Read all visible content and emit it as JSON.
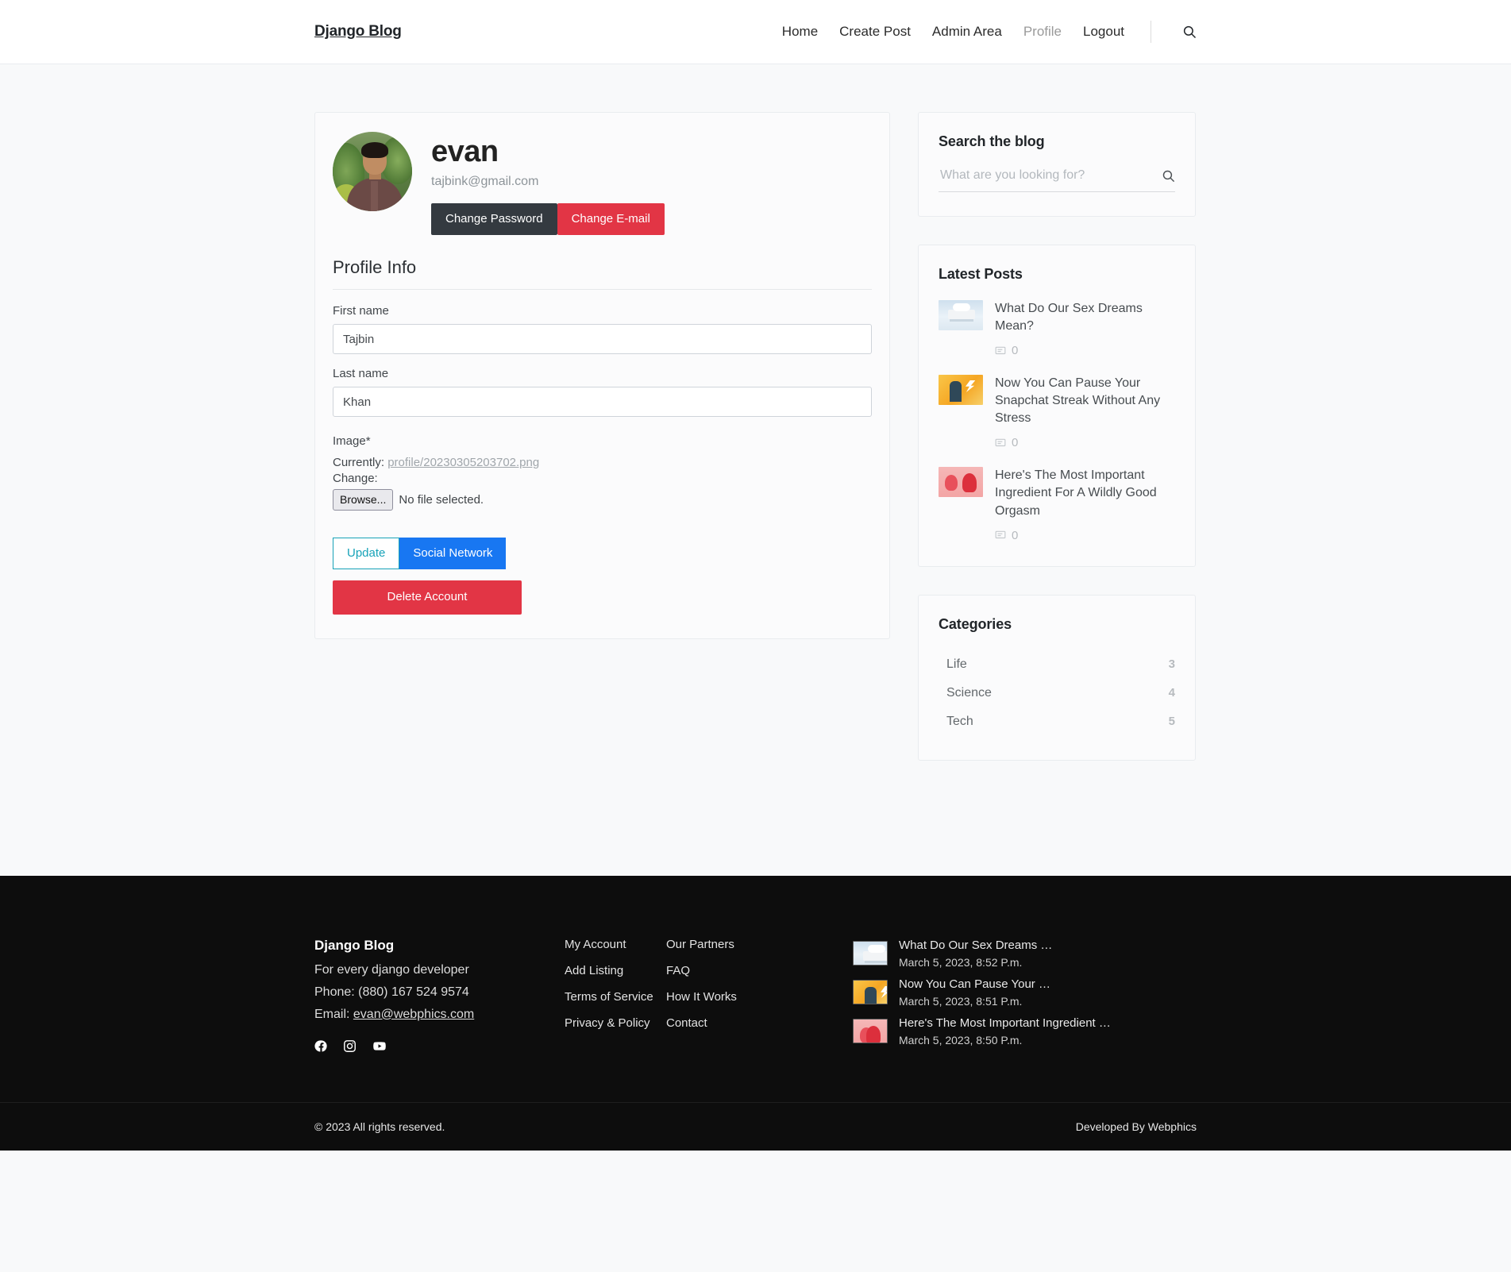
{
  "header": {
    "brand": "Django Blog",
    "nav": [
      {
        "label": "Home",
        "active": false
      },
      {
        "label": "Create Post",
        "active": false
      },
      {
        "label": "Admin Area",
        "active": false
      },
      {
        "label": "Profile",
        "active": true
      },
      {
        "label": "Logout",
        "active": false
      }
    ],
    "search_icon": "search-icon"
  },
  "profile": {
    "username": "evan",
    "email": "tajbink@gmail.com",
    "change_password_label": "Change Password",
    "change_email_label": "Change E-mail",
    "section_title": "Profile Info",
    "first_name_label": "First name",
    "first_name_value": "Tajbin",
    "last_name_label": "Last name",
    "last_name_value": "Khan",
    "image_label": "Image*",
    "currently_label": "Currently:",
    "currently_value": "profile/20230305203702.png",
    "change_label": "Change:",
    "browse_label": "Browse...",
    "file_status": "No file selected.",
    "update_label": "Update",
    "social_network_label": "Social Network",
    "delete_account_label": "Delete Account"
  },
  "sidebar": {
    "search": {
      "title": "Search the blog",
      "placeholder": "What are you looking for?",
      "value": ""
    },
    "latest_posts": {
      "title": "Latest Posts",
      "items": [
        {
          "title": "What Do Our Sex Dreams Mean?",
          "comments": "0",
          "thumb": "t-bed"
        },
        {
          "title": "Now You Can Pause Your Snapchat Streak Without Any Stress",
          "comments": "0",
          "thumb": "t-snap"
        },
        {
          "title": "Here's The Most Important Ingredient For A Wildly Good Orgasm",
          "comments": "0",
          "thumb": "t-orgasm"
        }
      ]
    },
    "categories": {
      "title": "Categories",
      "items": [
        {
          "name": "Life",
          "count": "3"
        },
        {
          "name": "Science",
          "count": "4"
        },
        {
          "name": "Tech",
          "count": "5"
        }
      ]
    }
  },
  "footer": {
    "brand": "Django Blog",
    "tagline": "For every django developer",
    "phone": "Phone: (880) 167 524 9574",
    "email_prefix": "Email: ",
    "email": "evan@webphics.com",
    "socials": [
      "facebook-icon",
      "instagram-icon",
      "youtube-icon"
    ],
    "links_col1": [
      "My Account",
      "Add Listing",
      "Terms of Service",
      "Privacy & Policy"
    ],
    "links_col2": [
      "Our Partners",
      "FAQ",
      "How It Works",
      "Contact"
    ],
    "recent_posts": [
      {
        "title": "What Do Our Sex Dreams …",
        "date": "March 5, 2023, 8:52 P.m.",
        "thumb": "t-bed"
      },
      {
        "title": "Now You Can Pause Your …",
        "date": "March 5, 2023, 8:51 P.m.",
        "thumb": "t-snap"
      },
      {
        "title": "Here's The Most Important Ingredient …",
        "date": "March 5, 2023, 8:50 P.m.",
        "thumb": "t-orgasm"
      }
    ],
    "copyright": "© 2023 All rights reserved.",
    "credit": "Developed By Webphics"
  },
  "colors": {
    "dark_button": "#343a40",
    "red": "#e23545",
    "primary_blue": "#1877f2",
    "info": "#17a2b8",
    "page_bg": "#f8f9fa",
    "footer_bg": "#0d0d0d"
  }
}
